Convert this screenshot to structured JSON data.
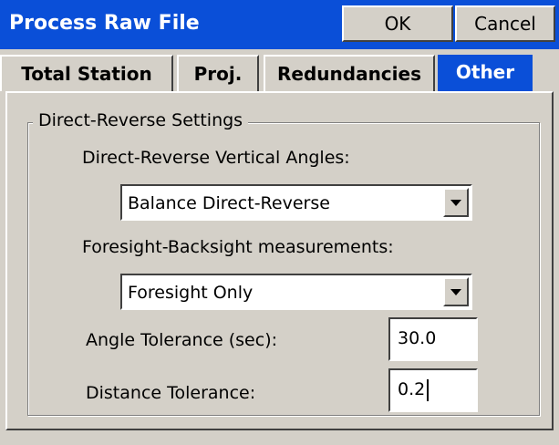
{
  "title": "Process Raw File",
  "buttons": {
    "ok": "OK",
    "cancel": "Cancel"
  },
  "tabs": [
    {
      "label": "Total Station",
      "active": false
    },
    {
      "label": "Proj.",
      "active": false
    },
    {
      "label": "Redundancies",
      "active": false
    },
    {
      "label": "Other",
      "active": true
    }
  ],
  "group": {
    "label": "Direct-Reverse Settings",
    "vertical_angles": {
      "label": "Direct-Reverse Vertical Angles:",
      "value": "Balance Direct-Reverse"
    },
    "fs_bs": {
      "label": "Foresight-Backsight measurements:",
      "value": "Foresight Only"
    },
    "angle_tol": {
      "label": "Angle Tolerance (sec):",
      "value": "30.0"
    },
    "dist_tol": {
      "label": "Distance Tolerance:",
      "value": "0.2"
    }
  },
  "colors": {
    "accent": "#0a4fd8",
    "background": "#d4d0c8"
  }
}
